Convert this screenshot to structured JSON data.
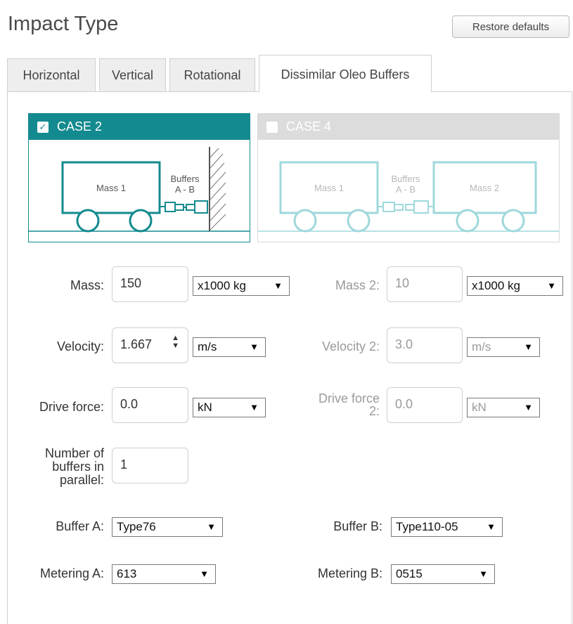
{
  "header": {
    "title": "Impact Type",
    "restore_label": "Restore defaults"
  },
  "tabs": [
    {
      "label": "Horizontal"
    },
    {
      "label": "Vertical"
    },
    {
      "label": "Rotational"
    },
    {
      "label": "Dissimilar Oleo Buffers",
      "active": true
    }
  ],
  "cases": [
    {
      "label": "CASE 2",
      "checked": true,
      "mass_label": "Mass 1",
      "buffers_label": "Buffers",
      "buffers_sub": "A - B",
      "color": "#138a8f"
    },
    {
      "label": "CASE 4",
      "checked": false,
      "mass1_label": "Mass 1",
      "mass2_label": "Mass 2",
      "buffers_label": "Buffers",
      "buffers_sub": "A - B",
      "color": "#9fd8dc"
    }
  ],
  "form": {
    "mass": {
      "label": "Mass:",
      "value": "150",
      "unit": "x1000 kg"
    },
    "mass2": {
      "label": "Mass 2:",
      "value": "10",
      "unit": "x1000 kg"
    },
    "velocity": {
      "label": "Velocity:",
      "value": "1.667",
      "unit": "m/s"
    },
    "velocity2": {
      "label": "Velocity 2:",
      "value": "3.0",
      "unit": "m/s"
    },
    "drive_force": {
      "label": "Drive force:",
      "value": "0.0",
      "unit": "kN"
    },
    "drive_force2": {
      "label_line1": "Drive force",
      "label_line2": "2:",
      "value": "0.0",
      "unit": "kN"
    },
    "num_buffers": {
      "label_line1": "Number of",
      "label_line2": "buffers in",
      "label_line3": "parallel:",
      "value": "1"
    },
    "buffer_a": {
      "label": "Buffer A:",
      "value": "Type76"
    },
    "buffer_b": {
      "label": "Buffer B:",
      "value": "Type110-05"
    },
    "metering_a": {
      "label": "Metering A:",
      "value": "613"
    },
    "metering_b": {
      "label": "Metering B:",
      "value": "0515"
    }
  },
  "icons": {
    "dropdown": "triangle-down-icon",
    "spinner": "spinner-arrows-icon",
    "checkbox": "checkbox-icon"
  }
}
